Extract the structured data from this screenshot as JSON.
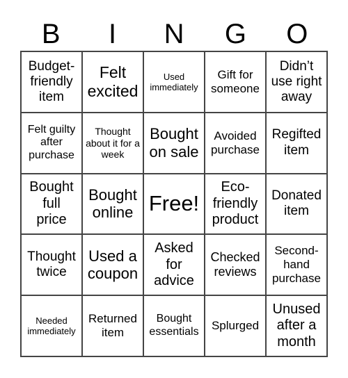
{
  "header": [
    "B",
    "I",
    "N",
    "G",
    "O"
  ],
  "cells": [
    "Budget-friendly item",
    "Felt excited",
    "Used immediately",
    "Gift for someone",
    "Didn’t use right away",
    "Felt guilty after purchase",
    "Thought about it for a week",
    "Bought on sale",
    "Avoided purchase",
    "Regifted item",
    "Bought full price",
    "Bought online",
    "Free!",
    "Eco-friendly product",
    "Donated item",
    "Thought twice",
    "Used a coupon",
    "Asked for advice",
    "Checked reviews",
    "Second-hand purchase",
    "Needed immediately",
    "Returned item",
    "Bought essentials",
    "Splurged",
    "Unused after a month"
  ]
}
